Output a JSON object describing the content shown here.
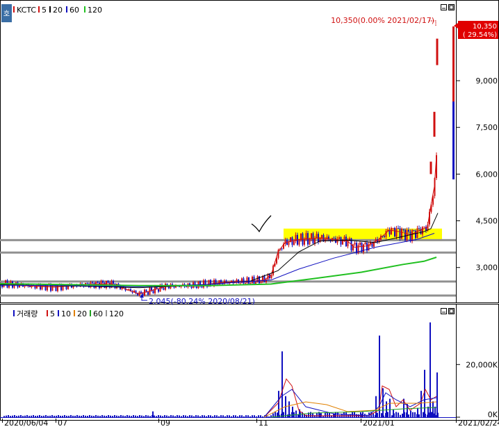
{
  "price_panel": {
    "symbol": "KCTC",
    "legend": [
      {
        "label": "5",
        "color": "#d01010"
      },
      {
        "label": "20",
        "color": "#000000"
      },
      {
        "label": "60",
        "color": "#1010c0"
      },
      {
        "label": "120",
        "color": "#20c020"
      }
    ],
    "last_label": "10,350(0.00% 2021/02/17)",
    "badge_price": "10,350",
    "badge_change": "( 29.54%)",
    "low_label": "2,045(-80.24% 2020/08/21)",
    "side_tab": "호"
  },
  "volume_panel": {
    "title": "거래량",
    "legend": [
      {
        "label": "5",
        "color": "#d01010"
      },
      {
        "label": "10",
        "color": "#1010c0"
      },
      {
        "label": "20",
        "color": "#e08000"
      },
      {
        "label": "60",
        "color": "#20a020"
      },
      {
        "label": "120",
        "color": "#909090"
      }
    ]
  },
  "date_labels": [
    "2020/06/04",
    "07",
    "09",
    "11",
    "2021/01",
    "2021/02/24"
  ],
  "colors": {
    "up": "#d01010",
    "down": "#1010c0",
    "highlight": "#ffff00",
    "support": "#909090"
  },
  "chart_data": [
    {
      "type": "candlestick",
      "title": "KCTC",
      "y_ticks": [
        "9,000",
        "7,500",
        "6,000",
        "4,500",
        "3,000"
      ],
      "y_tick_values": [
        9000,
        7500,
        6000,
        4500,
        3000
      ],
      "ylim": [
        1900,
        11100
      ],
      "x_range": [
        "2020/06/04",
        "2021/02/24"
      ],
      "series": [
        {
          "name": "5",
          "points": [
            [
              0,
              2500
            ],
            [
              40,
              2410
            ],
            [
              80,
              2370
            ],
            [
              120,
              2450
            ],
            [
              160,
              2480
            ],
            [
              200,
              2150
            ],
            [
              240,
              2400
            ],
            [
              280,
              2420
            ],
            [
              320,
              2520
            ],
            [
              360,
              2560
            ],
            [
              380,
              2600
            ],
            [
              390,
              2750
            ],
            [
              400,
              3500
            ],
            [
              410,
              3800
            ],
            [
              430,
              3900
            ],
            [
              460,
              3950
            ],
            [
              480,
              3900
            ],
            [
              500,
              3850
            ],
            [
              510,
              3650
            ],
            [
              530,
              3700
            ],
            [
              545,
              3900
            ],
            [
              560,
              4200
            ],
            [
              575,
              4150
            ],
            [
              590,
              4050
            ],
            [
              605,
              4200
            ],
            [
              615,
              4300
            ],
            [
              620,
              5000
            ],
            [
              625,
              5600
            ],
            [
              628,
              6600
            ]
          ]
        },
        {
          "name": "20",
          "points": [
            [
              0,
              2450
            ],
            [
              60,
              2420
            ],
            [
              120,
              2400
            ],
            [
              200,
              2350
            ],
            [
              280,
              2430
            ],
            [
              360,
              2560
            ],
            [
              400,
              2900
            ],
            [
              430,
              3500
            ],
            [
              460,
              3850
            ],
            [
              500,
              3880
            ],
            [
              540,
              3800
            ],
            [
              580,
              4000
            ],
            [
              610,
              4150
            ],
            [
              620,
              4250
            ],
            [
              630,
              4750
            ]
          ]
        },
        {
          "name": "60",
          "points": [
            [
              0,
              2430
            ],
            [
              100,
              2420
            ],
            [
              200,
              2380
            ],
            [
              300,
              2460
            ],
            [
              390,
              2600
            ],
            [
              430,
              2950
            ],
            [
              480,
              3300
            ],
            [
              540,
              3650
            ],
            [
              600,
              3900
            ],
            [
              625,
              4100
            ]
          ]
        },
        {
          "name": "120",
          "points": [
            [
              0,
              2480
            ],
            [
              100,
              2450
            ],
            [
              200,
              2420
            ],
            [
              300,
              2420
            ],
            [
              390,
              2470
            ],
            [
              450,
              2640
            ],
            [
              520,
              2850
            ],
            [
              580,
              3100
            ],
            [
              610,
              3200
            ],
            [
              628,
              3330
            ]
          ]
        }
      ],
      "support_levels": [
        3880,
        3480,
        2550,
        2100
      ],
      "highlight_range": [
        3850,
        4250
      ],
      "last": 10350,
      "last_change_pct": 0.0,
      "last_date": "2021/02/17",
      "change_pct_badge": 29.54,
      "low": 2045,
      "low_change_pct": -80.24,
      "low_date": "2020/08/21"
    },
    {
      "type": "bar",
      "title": "거래량",
      "y_ticks": [
        "20,000K",
        "0K"
      ],
      "y_tick_values": [
        20000,
        0
      ],
      "ylim": [
        0,
        37500
      ],
      "values": [
        [
          395,
          2000
        ],
        [
          400,
          10000
        ],
        [
          405,
          25000
        ],
        [
          410,
          8000
        ],
        [
          415,
          6000
        ],
        [
          420,
          4000
        ],
        [
          425,
          2500
        ],
        [
          430,
          3000
        ],
        [
          460,
          1500
        ],
        [
          480,
          1200
        ],
        [
          500,
          900
        ],
        [
          520,
          1200
        ],
        [
          540,
          8000
        ],
        [
          545,
          31000
        ],
        [
          550,
          11000
        ],
        [
          555,
          6000
        ],
        [
          560,
          7000
        ],
        [
          565,
          3000
        ],
        [
          580,
          7000
        ],
        [
          585,
          5000
        ],
        [
          590,
          2500
        ],
        [
          600,
          3500
        ],
        [
          605,
          10000
        ],
        [
          610,
          18000
        ],
        [
          615,
          4000
        ],
        [
          618,
          36000
        ],
        [
          622,
          6000
        ],
        [
          625,
          4000
        ],
        [
          628,
          17000
        ]
      ]
    }
  ]
}
